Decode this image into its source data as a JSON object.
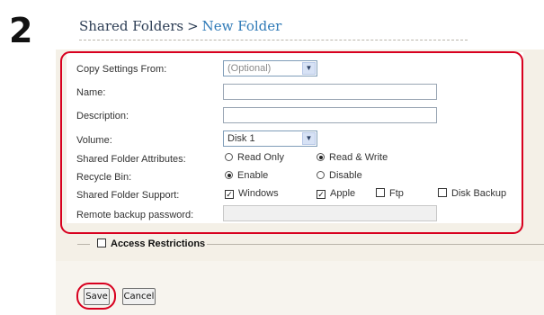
{
  "step": "2",
  "breadcrumb": {
    "parent": "Shared Folders",
    "separator": ">",
    "current": "New Folder"
  },
  "form": {
    "copy_settings": {
      "label": "Copy Settings From:",
      "value": "(Optional)"
    },
    "name": {
      "label": "Name:",
      "value": ""
    },
    "description": {
      "label": "Description:",
      "value": ""
    },
    "volume": {
      "label": "Volume:",
      "value": "Disk 1"
    },
    "attributes": {
      "label": "Shared Folder Attributes:",
      "read_only": "Read Only",
      "read_write": "Read & Write",
      "selected": "Read & Write"
    },
    "recycle_bin": {
      "label": "Recycle Bin:",
      "enable": "Enable",
      "disable": "Disable",
      "selected": "Enable"
    },
    "support": {
      "label": "Shared Folder Support:",
      "windows": "Windows",
      "apple": "Apple",
      "ftp": "Ftp",
      "disk_backup": "Disk Backup",
      "checked": [
        "Windows",
        "Apple"
      ]
    },
    "remote_backup": {
      "label": "Remote backup password:",
      "value": ""
    }
  },
  "access_restrictions": {
    "label": "Access Restrictions",
    "checked": false
  },
  "buttons": {
    "save": "Save",
    "cancel": "Cancel"
  },
  "colors": {
    "highlight": "#d8001f",
    "link": "#2f7ab7",
    "panel_bg": "#f4f0e7"
  }
}
